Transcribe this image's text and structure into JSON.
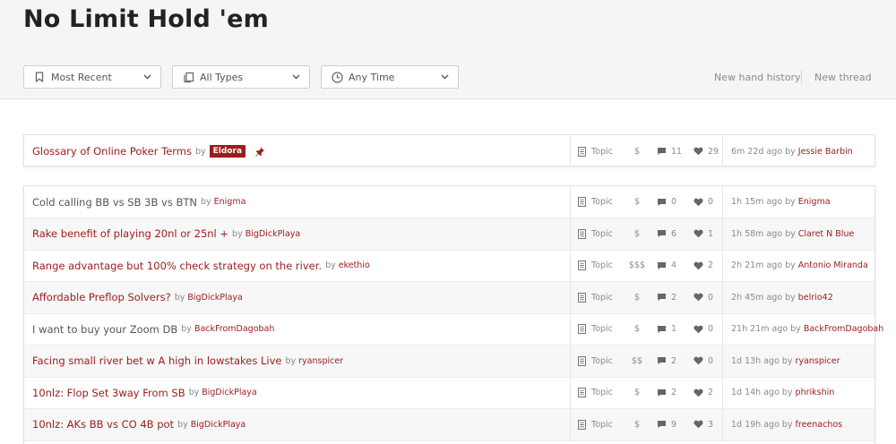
{
  "page": {
    "title": "No Limit Hold 'em"
  },
  "filters": {
    "sort": {
      "value": "Most Recent",
      "icon": "bookmark-icon"
    },
    "type": {
      "value": "All Types",
      "icon": "copy-icon"
    },
    "time": {
      "value": "Any Time",
      "icon": "clock-icon"
    }
  },
  "actions": {
    "new_hand_history": "New hand history",
    "new_thread": "New thread"
  },
  "colors": {
    "accent": "#9b1c1c",
    "muted": "#8a8a8a",
    "header_bg": "#f5f5f5"
  },
  "pinned": {
    "title": "Glossary of Online Poker Terms",
    "by": "by",
    "author": "Eldora",
    "type": "Topic",
    "price": "$",
    "replies": "11",
    "likes": "29",
    "time": "6m 22d ago",
    "time_by": "by",
    "last_user": "Jessie Barbin"
  },
  "threads": [
    {
      "title": "Cold calling BB vs SB 3B vs BTN",
      "by": "by",
      "author": "Enigma",
      "type": "Topic",
      "price": "$",
      "replies": "0",
      "likes": "0",
      "time": "1h 15m ago",
      "time_by": "by",
      "last_user": "Enigma"
    },
    {
      "title": "Rake benefit of playing 20nl or 25nl +",
      "by": "by",
      "author": "BigDickPlaya",
      "type": "Topic",
      "price": "$",
      "replies": "6",
      "likes": "1",
      "time": "1h 58m ago",
      "time_by": "by",
      "last_user": "Claret N Blue"
    },
    {
      "title": "Range advantage but 100% check strategy on the river.",
      "by": "by",
      "author": "ekethio",
      "type": "Topic",
      "price": "$$$",
      "replies": "4",
      "likes": "2",
      "time": "2h 21m ago",
      "time_by": "by",
      "last_user": "Antonio Miranda"
    },
    {
      "title": "Affordable Preflop Solvers?",
      "by": "by",
      "author": "BigDickPlaya",
      "type": "Topic",
      "price": "$",
      "replies": "2",
      "likes": "0",
      "time": "2h 45m ago",
      "time_by": "by",
      "last_user": "belrio42"
    },
    {
      "title": "I want to buy your Zoom DB",
      "by": "by",
      "author": "BackFromDagobah",
      "type": "Topic",
      "price": "$",
      "replies": "1",
      "likes": "0",
      "time": "21h 21m ago",
      "time_by": "by",
      "last_user": "BackFromDagobah"
    },
    {
      "title": "Facing small river bet w A high in lowstakes Live",
      "by": "by",
      "author": "ryanspicer",
      "type": "Topic",
      "price": "$$",
      "replies": "2",
      "likes": "0",
      "time": "1d 13h ago",
      "time_by": "by",
      "last_user": "ryanspicer"
    },
    {
      "title": "10nlz: Flop Set 3way From SB",
      "by": "by",
      "author": "BigDickPlaya",
      "type": "Topic",
      "price": "$",
      "replies": "2",
      "likes": "2",
      "time": "1d 14h ago",
      "time_by": "by",
      "last_user": "phrikshin"
    },
    {
      "title": "10nlz: AKs BB vs CO 4B pot",
      "by": "by",
      "author": "BigDickPlaya",
      "type": "Topic",
      "price": "$",
      "replies": "9",
      "likes": "3",
      "time": "1d 19h ago",
      "time_by": "by",
      "last_user": "freenachos"
    }
  ]
}
